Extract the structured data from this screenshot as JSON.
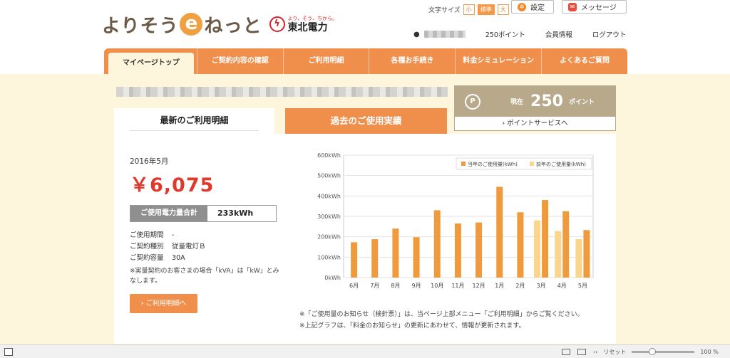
{
  "header": {
    "logo_text_1": "よりそう",
    "logo_e": "e",
    "logo_text_2": "ねっと",
    "partner_tagline": "より、そう、ちから。",
    "partner_name": "東北電力",
    "font_size_label": "文字サイズ",
    "font_sizes": [
      "小",
      "標準",
      "大"
    ],
    "settings_label": "設定",
    "message_label": "メッセージ",
    "points_link": "250ポイント",
    "member_info": "会員情報",
    "logout": "ログアウト"
  },
  "nav": {
    "items": [
      "マイページトップ",
      "ご契約内容の確認",
      "ご利用明細",
      "各種お手続き",
      "料金シミュレーション",
      "よくあるご質問"
    ],
    "active_index": 0
  },
  "points": {
    "label": "現在",
    "value": "250",
    "unit": "ポイント",
    "link": "ポイントサービスへ"
  },
  "tabs": {
    "latest": "最新のご利用明細",
    "history": "過去のご使用実績"
  },
  "bill": {
    "month": "2016年5月",
    "amount": "￥6,075",
    "usage_label": "ご使用電力量合計",
    "usage_value": "233kWh",
    "rows": [
      {
        "k": "ご使用期間",
        "v": "-"
      },
      {
        "k": "ご契約種別",
        "v": "従量電灯Ｂ"
      },
      {
        "k": "ご契約容量",
        "v": "30A"
      }
    ],
    "note": "※実量契約のお客さまの場合「kVA」は「kW」とみなします。",
    "detail_button": "ご利用明細へ"
  },
  "chart_data": {
    "type": "bar",
    "categories": [
      "6月",
      "7月",
      "8月",
      "9月",
      "10月",
      "11月",
      "12月",
      "1月",
      "2月",
      "3月",
      "4月",
      "5月"
    ],
    "series": [
      {
        "name": "当年のご使用量(kWh)",
        "color": "#ef9a3c",
        "values": [
          173,
          188,
          240,
          198,
          330,
          265,
          270,
          445,
          320,
          380,
          325,
          233
        ]
      },
      {
        "name": "前年のご使用量(kWh)",
        "color": "#fbd58c",
        "values": [
          null,
          null,
          null,
          null,
          null,
          null,
          null,
          null,
          null,
          280,
          228,
          188
        ]
      }
    ],
    "yticks": [
      "0kWh",
      "100kWh",
      "200kWh",
      "300kWh",
      "400kWh",
      "500kWh",
      "600kWh"
    ],
    "ylim": [
      0,
      600
    ],
    "grid": true,
    "legend": "top-right"
  },
  "footnotes": [
    "※「ご使用量のお知らせ（検針票）」は、当ページ上部メニュー「ご利用明細」からご覧ください。",
    "※上記グラフは、「料金のお知らせ」の更新にあわせて、情報が更新されます。"
  ],
  "statusbar": {
    "reset": "リセット",
    "zoom": "100 %"
  }
}
